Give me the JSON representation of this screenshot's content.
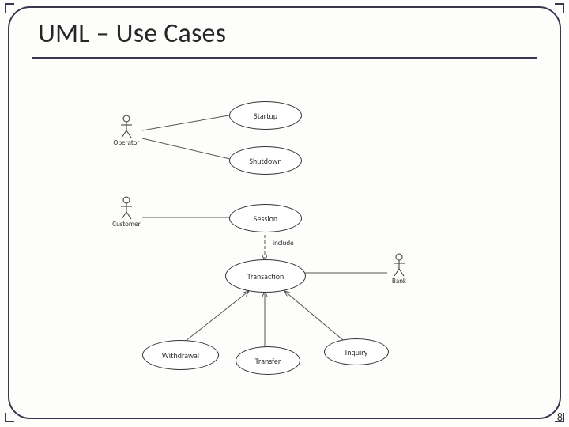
{
  "title": "UML – Use Cases",
  "page_number": "8",
  "actors": {
    "operator": "Operator",
    "customer": "Customer",
    "bank": "Bank"
  },
  "usecases": {
    "startup": "Startup",
    "shutdown": "Shutdown",
    "session": "Session",
    "transaction": "Transaction",
    "withdrawal": "Withdrawal",
    "transfer": "Transfer",
    "inquiry": "Inquiry"
  },
  "relations": {
    "include": "include"
  }
}
